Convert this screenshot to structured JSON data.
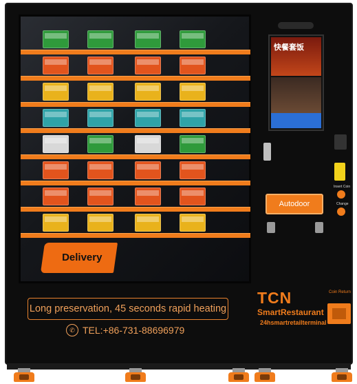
{
  "machine": {
    "delivery_label": "Delivery",
    "autodoor_label": "Autodoor",
    "screen_text": "快餐套饭",
    "banner_text": "Long preservation, 45 seconds rapid heating",
    "phone_text": "TEL:+86-731-88696979",
    "brand": "TCN",
    "brand_line2": "SmartRestaurant",
    "brand_line3": "24hsmartretailterminal",
    "coin_return_label": "Coin Return",
    "insert_coin_label": "Insert Coin",
    "change_label": "Change"
  },
  "colors": {
    "accent": "#f07c1c",
    "body": "#0d0d0d"
  },
  "shelf_rows": [
    [
      "#2f9a3b",
      "#2f9a3b",
      "#2f9a3b",
      "#2f9a3b"
    ],
    [
      "#e2541d",
      "#e2541d",
      "#e2541d",
      "#e2541d"
    ],
    [
      "#e9b21c",
      "#e9b21c",
      "#e9b21c",
      "#e9b21c"
    ],
    [
      "#2fa3a8",
      "#2fa3a8",
      "#2fa3a8",
      "#2fa3a8"
    ],
    [
      "#d8d8d8",
      "#2f9a3b",
      "#d8d8d8",
      "#2f9a3b"
    ],
    [
      "#e2541d",
      "#e2541d",
      "#e2541d",
      "#e2541d"
    ],
    [
      "#e2541d",
      "#e2541d",
      "#e2541d",
      "#e2541d"
    ],
    [
      "#e9b21c",
      "#e9b21c",
      "#e9b21c",
      "#e9b21c"
    ]
  ]
}
